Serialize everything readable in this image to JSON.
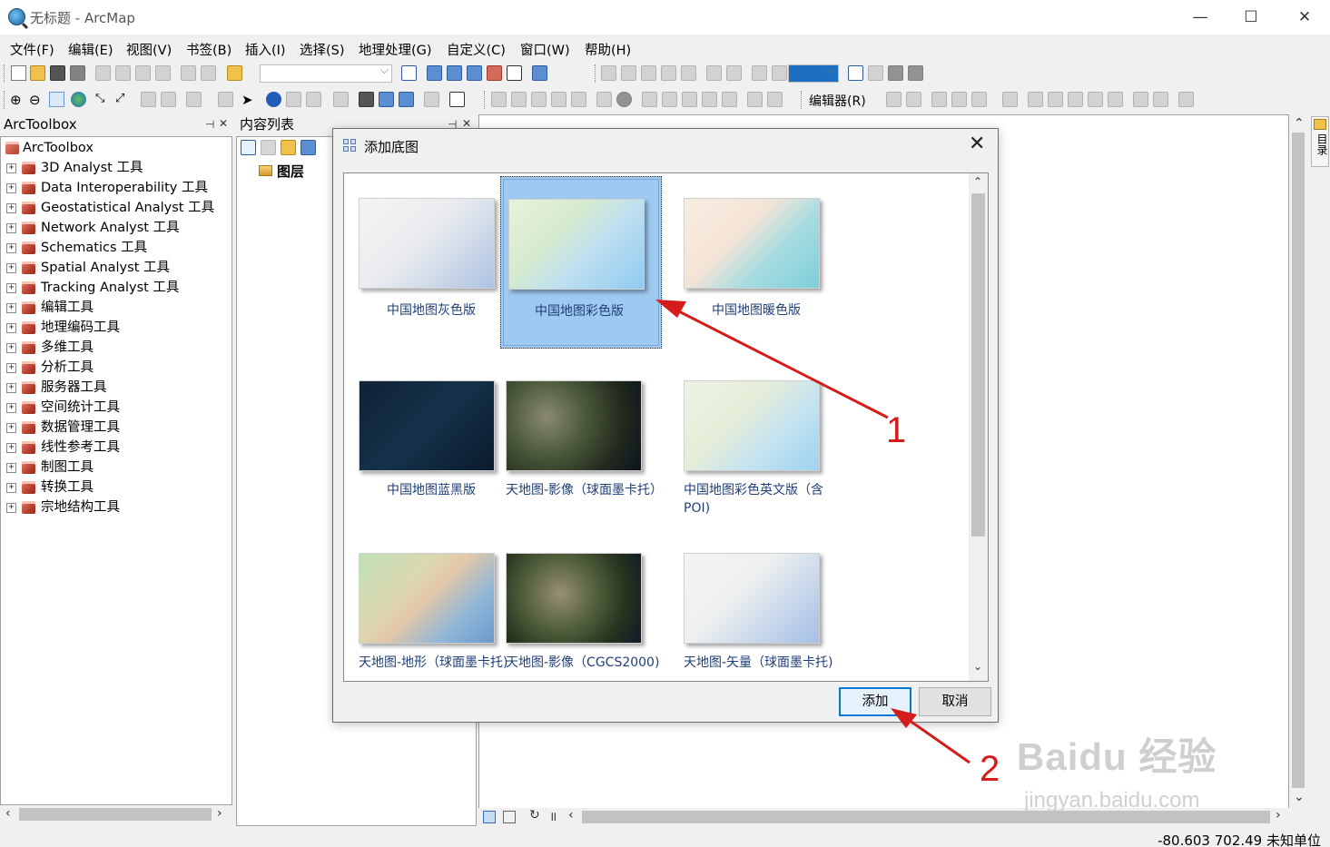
{
  "window": {
    "title": "无标题 - ArcMap",
    "minimize": "—",
    "maximize": "☐",
    "close": "✕"
  },
  "menu": [
    "文件(F)",
    "编辑(E)",
    "视图(V)",
    "书签(B)",
    "插入(I)",
    "选择(S)",
    "地理处理(G)",
    "自定义(C)",
    "窗口(W)",
    "帮助(H)"
  ],
  "toolbar": {
    "editor_label": "编辑器(R)",
    "scale_value": ""
  },
  "toolbox": {
    "title": "ArcToolbox",
    "pin": "⊣",
    "close": "✕",
    "root": "ArcToolbox",
    "items": [
      "3D Analyst 工具",
      "Data Interoperability 工具",
      "Geostatistical Analyst 工具",
      "Network Analyst 工具",
      "Schematics 工具",
      "Spatial Analyst 工具",
      "Tracking Analyst 工具",
      "编辑工具",
      "地理编码工具",
      "多维工具",
      "分析工具",
      "服务器工具",
      "空间统计工具",
      "数据管理工具",
      "线性参考工具",
      "制图工具",
      "转换工具",
      "宗地结构工具"
    ]
  },
  "toc": {
    "title": "内容列表",
    "layers_label": "图层"
  },
  "side_tab": "目录",
  "dialog": {
    "title": "添加底图",
    "close": "✕",
    "tiles": [
      {
        "label": "中国地图灰色版",
        "style": "gray",
        "selected": false
      },
      {
        "label": "中国地图彩色版",
        "style": "color",
        "selected": true
      },
      {
        "label": "中国地图暖色版",
        "style": "warm",
        "selected": false
      },
      {
        "label": "中国地图蓝黑版",
        "style": "dark",
        "selected": false
      },
      {
        "label": "天地图-影像（球面墨卡托）",
        "style": "imagery",
        "selected": false
      },
      {
        "label": "中国地图彩色英文版（含POI)",
        "style": "color-en",
        "selected": false
      },
      {
        "label": "天地图-地形（球面墨卡托)",
        "style": "terrain",
        "selected": false
      },
      {
        "label": "天地图-影像（CGCS2000)",
        "style": "imagery2",
        "selected": false
      },
      {
        "label": "天地图-矢量（球面墨卡托)",
        "style": "vector",
        "selected": false
      }
    ],
    "add_button": "添加",
    "cancel_button": "取消"
  },
  "annotations": {
    "arrow1_label": "1",
    "arrow2_label": "2",
    "color": "#d61b1b"
  },
  "status": {
    "coordinates": "-80.603  702.49 未知单位"
  },
  "watermark": {
    "brand": "Baidu 经验",
    "url": "jingyan.baidu.com"
  }
}
